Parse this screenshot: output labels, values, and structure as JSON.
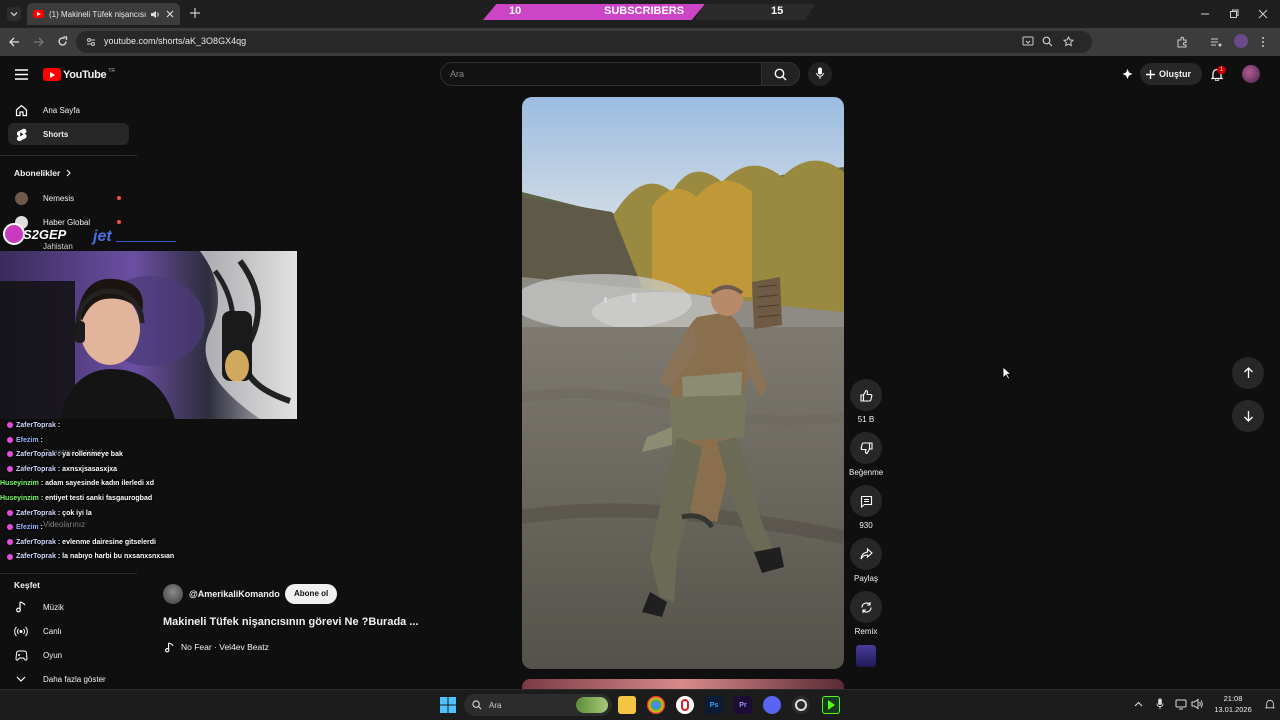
{
  "browser": {
    "tab_title": "(1) Makineli Tüfek nişancısı",
    "url": "youtube.com/shorts/aK_3O8GX4qg"
  },
  "overlay": {
    "subs_left_value": "10",
    "subs_label": "SUBSCRIBERS",
    "subs_right_value": "15",
    "streamer_logo": "S2GEP",
    "sponsor_logo": "jet"
  },
  "header": {
    "logo_text": "YouTube",
    "region": "TR",
    "search_placeholder": "Ara",
    "create_label": "Oluştur",
    "notification_count": "1"
  },
  "sidebar": {
    "home": "Ana Sayfa",
    "shorts": "Shorts",
    "subscriptions_heading": "Abonelikler",
    "subscriptions": [
      "Nemesis",
      "Haber Global",
      "Jahistan"
    ],
    "faded_items": [
      "Oynatma listeleri",
      "Videolarınız"
    ],
    "explore_heading": "Keşfet",
    "explore": [
      "Müzik",
      "Canlı",
      "Oyun"
    ],
    "show_more": "Daha fazla göster"
  },
  "chat": [
    {
      "user": "ZaferToprak",
      "msg": "",
      "color": "#cfd6ff",
      "badge": true
    },
    {
      "user": "Efezim",
      "msg": "",
      "color": "#9db4ff",
      "badge": true
    },
    {
      "user": "ZaferToprak",
      "msg": "ya rollenmeye bak",
      "color": "#cfd6ff",
      "badge": true
    },
    {
      "user": "ZaferToprak",
      "msg": "axnsxjsasasxjxa",
      "color": "#cfd6ff",
      "badge": true
    },
    {
      "user": "Huseyinzim",
      "msg": "adam sayesinde kadın ilerledi xd",
      "color": "#7CFF6B",
      "badge": false
    },
    {
      "user": "Huseyinzim",
      "msg": "entiyet testi sanki fasgaurogbad",
      "color": "#7CFF6B",
      "badge": false
    },
    {
      "user": "ZaferToprak",
      "msg": "çok iyi la",
      "color": "#cfd6ff",
      "badge": true
    },
    {
      "user": "Efezim",
      "msg": "",
      "color": "#9db4ff",
      "badge": true
    },
    {
      "user": "ZaferToprak",
      "msg": "evlenme dairesine gitselerdi",
      "color": "#cfd6ff",
      "badge": true
    },
    {
      "user": "ZaferToprak",
      "msg": "la nabıyo harbi bu nxsanxsnxsıan",
      "color": "#cfd6ff",
      "badge": true
    }
  ],
  "short": {
    "channel": "@AmerikaliKomando",
    "subscribe_label": "Abone ol",
    "title": "Makineli Tüfek nişancısının görevi Ne ?Burada ...",
    "audio": "No Fear · Vel4ev Beatz"
  },
  "actions": {
    "like_count": "51 B",
    "dislike_label": "Beğenme",
    "comment_count": "930",
    "share_label": "Paylaş",
    "remix_label": "Remix"
  },
  "taskbar": {
    "search_placeholder": "Ara",
    "time": "21:08",
    "date": "13.01.2026"
  },
  "colors": {
    "background": "#0f0f0f",
    "youtube_red": "#ff0000",
    "subs_pink": "#cc45c6"
  }
}
